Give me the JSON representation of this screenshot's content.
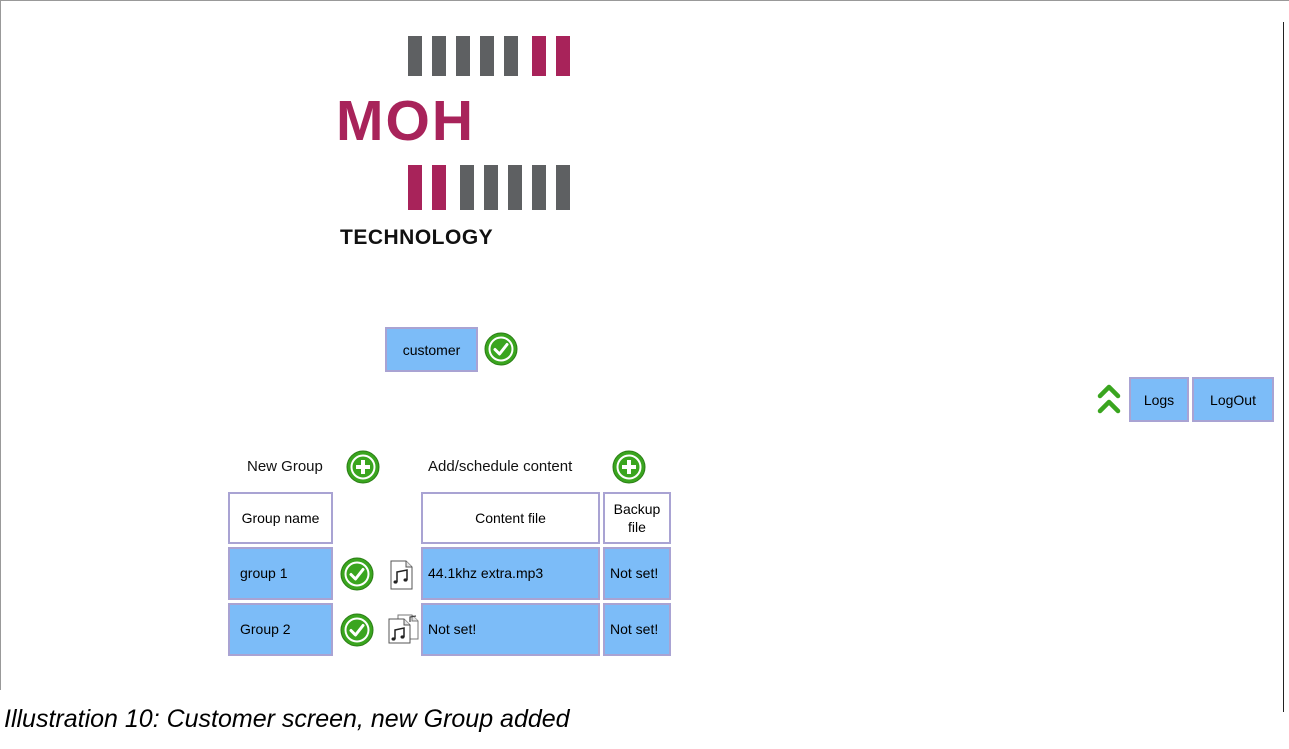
{
  "logo": {
    "name": "MOH",
    "sub": "TECHNOLOGY",
    "accent": "#a8235a",
    "gray": "#5e6062"
  },
  "customer_button": "customer",
  "nav": {
    "logs": "Logs",
    "logout": "LogOut"
  },
  "new_group_label": "New Group",
  "add_content_label": "Add/schedule content",
  "table": {
    "headers": {
      "group_name": "Group name",
      "content_file": "Content file",
      "backup_file": "Backup file"
    },
    "rows": [
      {
        "group": "group 1",
        "content": "44.1khz extra.mp3",
        "backup": "Not set!"
      },
      {
        "group": "Group 2",
        "content": "Not set!",
        "backup": "Not set!"
      }
    ]
  },
  "caption": "Illustration 10: Customer screen, new Group added",
  "colors": {
    "button_fill": "#7cbcf8",
    "button_border": "#a9a3d3",
    "icon_green": "#3aa51f"
  }
}
